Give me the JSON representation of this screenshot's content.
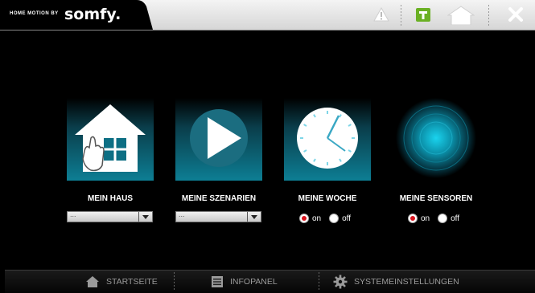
{
  "header": {
    "brand_small": "HOME MOTION BY",
    "brand": "somfy."
  },
  "icons": {
    "warning": "warning-icon",
    "device": "device-icon",
    "home": "home-icon",
    "close": "close-icon"
  },
  "colors": {
    "accent": "#0d7e94",
    "device_green": "#6ab023",
    "radio_red": "#d8141e"
  },
  "tiles": [
    {
      "label": "MEIN HAUS",
      "control": "dropdown",
      "value": "..."
    },
    {
      "label": "MEINE SZENARIEN",
      "control": "dropdown",
      "value": "..."
    },
    {
      "label": "MEINE WOCHE",
      "control": "radio",
      "on_label": "on",
      "off_label": "off",
      "selected": "on"
    },
    {
      "label": "MEINE SENSOREN",
      "control": "radio",
      "on_label": "on",
      "off_label": "off",
      "selected": "on"
    }
  ],
  "footer": {
    "startseite": "STARTSEITE",
    "infopanel": "INFOPANEL",
    "systemeinstellungen": "SYSTEMEINSTELLUNGEN"
  }
}
